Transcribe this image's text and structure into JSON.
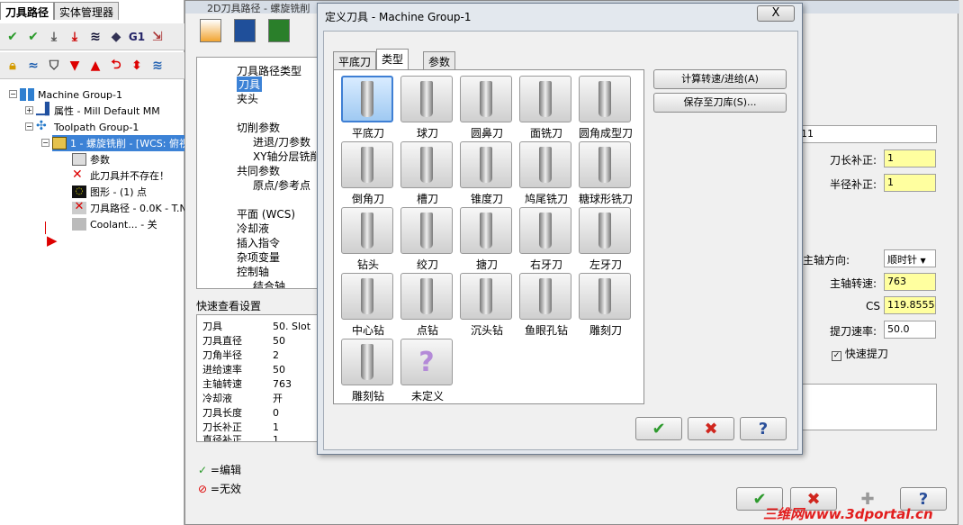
{
  "left": {
    "tabs": [
      "刀具路径",
      "实体管理器"
    ],
    "tree": {
      "root": "Machine Group-1",
      "props": "属性 - Mill Default MM",
      "group": "Toolpath Group-1",
      "op": "1 - 螺旋铣削 - [WCS: 俯视",
      "params": "参数",
      "notool": "此刀具并不存在！",
      "geom": "图形 - (1) 点",
      "path": "刀具路径 - 0.0K - T.N",
      "coolant": "Coolant... - 关"
    },
    "toolbar_g1": "G1"
  },
  "middle": {
    "title": "2D刀具路径 - 螺旋铣削",
    "tree": [
      "刀具路径类型",
      "刀具",
      "夹头",
      "切削参数",
      "进退/刀参数",
      "XY轴分层铣削",
      "共同参数",
      "原点/参考点",
      "平面 (WCS)",
      "冷却液",
      "插入指令",
      "杂项变量",
      "控制轴",
      "结合轴"
    ],
    "quickview_label": "快速查看设置",
    "quickview": [
      {
        "k": "刀具",
        "v": "50. Slot"
      },
      {
        "k": "刀具直径",
        "v": "50"
      },
      {
        "k": "刀角半径",
        "v": "2"
      },
      {
        "k": "进给速率",
        "v": "50"
      },
      {
        "k": "主轴转速",
        "v": "763"
      },
      {
        "k": "冷却液",
        "v": "开"
      },
      {
        "k": "刀具长度",
        "v": "0"
      },
      {
        "k": "刀长补正",
        "v": "1"
      },
      {
        "k": "直径补正",
        "v": "1"
      }
    ],
    "legend_edit": "=编辑",
    "legend_invalid": "=无效",
    "right": {
      "name_tail": "11",
      "len_comp_label": "刀长补正:",
      "len_comp": "1",
      "rad_comp_label": "半径补正:",
      "rad_comp": "1",
      "spindle_dir_label": "主轴方向:",
      "spindle_dir": "顺时针",
      "spindle_speed_label": "主轴转速:",
      "spindle_speed": "763",
      "cs_label": "CS",
      "cs": "119.8555",
      "plunge_label": "提刀速率:",
      "plunge": "50.0",
      "rapid_label": "快速提刀"
    }
  },
  "dialog": {
    "title": "定义刀具 - Machine Group-1",
    "close": "X",
    "tabs": [
      "平底刀",
      "类型",
      "参数"
    ],
    "active_tab": 1,
    "tools": [
      {
        "label": "平底刀",
        "icon": "flat-endmill"
      },
      {
        "label": "球刀",
        "icon": "ball-endmill"
      },
      {
        "label": "圆鼻刀",
        "icon": "bull-endmill"
      },
      {
        "label": "面铣刀",
        "icon": "face-mill"
      },
      {
        "label": "圆角成型刀",
        "icon": "corner-round"
      },
      {
        "label": "倒角刀",
        "icon": "chamfer"
      },
      {
        "label": "槽刀",
        "icon": "slot"
      },
      {
        "label": "锥度刀",
        "icon": "taper"
      },
      {
        "label": "鸠尾铣刀",
        "icon": "dovetail"
      },
      {
        "label": "糖球形铣刀",
        "icon": "lollipop"
      },
      {
        "label": "钻头",
        "icon": "drill"
      },
      {
        "label": "绞刀",
        "icon": "reamer"
      },
      {
        "label": "搪刀",
        "icon": "bore-bar"
      },
      {
        "label": "右牙刀",
        "icon": "right-tap"
      },
      {
        "label": "左牙刀",
        "icon": "left-tap"
      },
      {
        "label": "中心钻",
        "icon": "center-drill"
      },
      {
        "label": "点钻",
        "icon": "spot-drill"
      },
      {
        "label": "沉头钻",
        "icon": "countersink"
      },
      {
        "label": "鱼眼孔钻",
        "icon": "counterbore"
      },
      {
        "label": "雕刻刀",
        "icon": "engrave"
      },
      {
        "label": "雕刻钻",
        "icon": "engrave-drill"
      },
      {
        "label": "未定义",
        "icon": "undefined"
      }
    ],
    "calc_button": "计算转速/进给(A)",
    "save_button": "保存至刀库(S)..."
  },
  "watermark": "三维网www.3dportal.cn",
  "colors": {
    "ok": "#2e9a2e",
    "cancel": "#d0261e",
    "field_yellow": "#ffff9f",
    "selection": "#3e7fd4"
  }
}
